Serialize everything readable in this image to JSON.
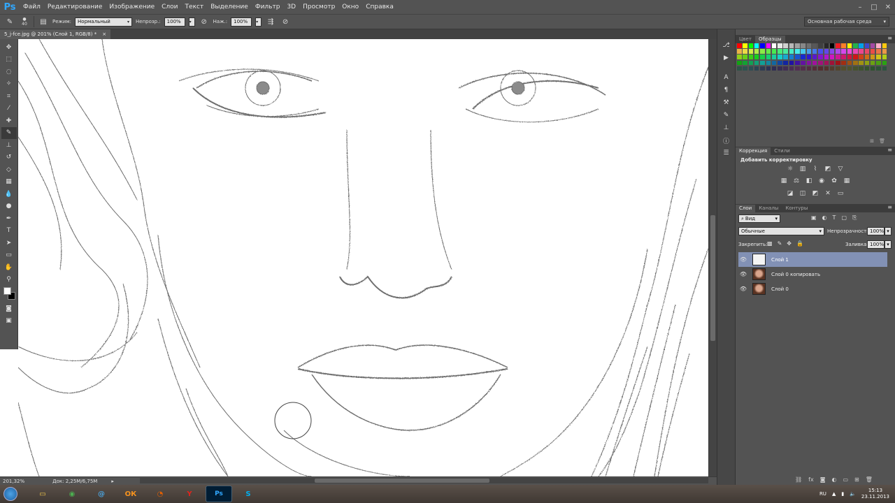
{
  "app": {
    "logo": "Ps"
  },
  "menu": [
    "Файл",
    "Редактирование",
    "Изображение",
    "Слои",
    "Текст",
    "Выделение",
    "Фильтр",
    "3D",
    "Просмотр",
    "Окно",
    "Справка"
  ],
  "options": {
    "brush_size": "40",
    "mode_label": "Режим:",
    "mode_value": "Нормальный",
    "opacity_label": "Непрозр.:",
    "opacity_value": "100%",
    "flow_label": "Наж.:",
    "flow_value": "100%"
  },
  "workspace": {
    "label": "Основная рабочая среда"
  },
  "document": {
    "tab_title": "5_j-fce.jpg @ 201% (Слой 1, RGB/8) *",
    "close": "×"
  },
  "status": {
    "zoom": "201,32%",
    "doc_size": "Док: 2,25M/6,75M"
  },
  "color_panel": {
    "tabs": [
      "Цвет",
      "Образцы"
    ],
    "active_tab": 1
  },
  "adjustments_panel": {
    "tabs": [
      "Коррекция",
      "Стили"
    ],
    "active_tab": 0,
    "title": "Добавить корректировку"
  },
  "layers_panel": {
    "tabs": [
      "Слои",
      "Каналы",
      "Контуры"
    ],
    "active_tab": 0,
    "filter_value": "Вид",
    "blend_mode": "Обычные",
    "opacity_label": "Непрозрачность:",
    "opacity_value": "100%",
    "lock_label": "Закрепить:",
    "fill_label": "Заливка:",
    "fill_value": "100%",
    "layers": [
      {
        "name": "Слой 1",
        "selected": true,
        "thumb": "sketch"
      },
      {
        "name": "Слой 0 копировать",
        "selected": false,
        "thumb": "photo"
      },
      {
        "name": "Слой 0",
        "selected": false,
        "thumb": "photo"
      }
    ]
  },
  "taskbar": {
    "apps": [
      "explorer-icon",
      "chrome-icon",
      "mail-icon",
      "odnoklassniki-icon",
      "firefox-icon",
      "yandex-icon",
      "photoshop-icon",
      "skype-icon"
    ],
    "active_app": "photoshop-icon",
    "lang": "RU",
    "time": "15:13",
    "date": "23.11.2013"
  },
  "colors": {
    "accent": "#31a8ff",
    "panel": "#535353",
    "layer_selected": "#8291b5"
  }
}
